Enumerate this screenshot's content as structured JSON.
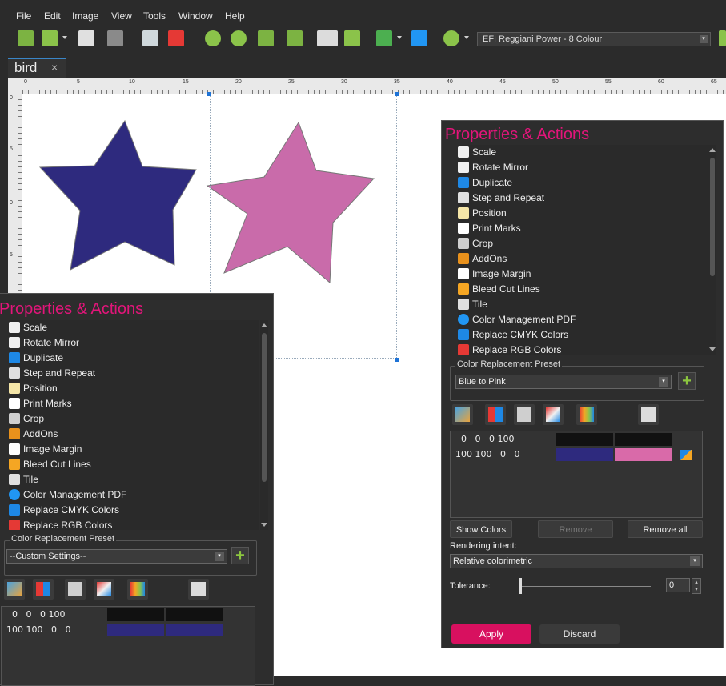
{
  "menu": [
    "File",
    "Edit",
    "Image",
    "View",
    "Tools",
    "Window",
    "Help"
  ],
  "toolbar": {
    "device": "EFI Reggiani Power - 8 Colour"
  },
  "document": {
    "tab_name": "bird",
    "tab_close": "×"
  },
  "ruler": {
    "h_ticks": [
      "0",
      "5",
      "10",
      "15",
      "20",
      "25",
      "30",
      "35",
      "40",
      "45",
      "50",
      "55",
      "60",
      "65"
    ],
    "v_ticks": [
      "0",
      "5",
      "0",
      "5"
    ]
  },
  "shapes": {
    "star1_color": "#2e2a7e",
    "star2_color": "#c96baa"
  },
  "panel_right": {
    "title": "Properties & Actions",
    "items": [
      "Scale",
      "Rotate Mirror",
      "Duplicate",
      "Step and Repeat",
      "Position",
      "Print Marks",
      "Crop",
      "AddOns",
      "Image Margin",
      "Bleed Cut Lines",
      "Tile",
      "Color Management PDF",
      "Replace CMYK Colors",
      "Replace RGB Colors"
    ],
    "preset_label": "Color Replacement Preset",
    "preset_value": "Blue to Pink",
    "plus": "+",
    "rows": [
      {
        "vals": "  0   0   0 100",
        "from": "#111111",
        "to": "#111111"
      },
      {
        "vals": "100 100   0   0",
        "from": "#2e2a7e",
        "to": "#d96aa9"
      }
    ],
    "show_colors": "Show Colors",
    "remove": "Remove",
    "remove_all": "Remove all",
    "rendering_label": "Rendering intent:",
    "rendering_value": "Relative colorimetric",
    "tolerance_label": "Tolerance:",
    "tolerance_value": "0",
    "apply": "Apply",
    "discard": "Discard"
  },
  "panel_left": {
    "title": "Properties & Actions",
    "items": [
      "Scale",
      "Rotate Mirror",
      "Duplicate",
      "Step and Repeat",
      "Position",
      "Print Marks",
      "Crop",
      "AddOns",
      "Image Margin",
      "Bleed Cut Lines",
      "Tile",
      "Color Management PDF",
      "Replace CMYK Colors",
      "Replace RGB Colors"
    ],
    "preset_label": "Color Replacement Preset",
    "preset_value": "--Custom Settings--",
    "plus": "+",
    "rows": [
      {
        "vals": "  0   0   0 100",
        "from": "#111111",
        "to": "#111111"
      },
      {
        "vals": "100 100   0   0",
        "from": "#2e2a7e",
        "to": "#2e2a7e"
      }
    ]
  },
  "icons": [
    "scale-icon",
    "rotate-mirror-icon",
    "duplicate-icon",
    "step-repeat-icon",
    "position-icon",
    "print-marks-icon",
    "crop-icon",
    "addons-icon",
    "image-margin-icon",
    "bleed-cut-lines-icon",
    "tile-icon",
    "color-management-pdf-icon",
    "replace-cmyk-icon",
    "replace-rgb-icon"
  ],
  "colors": {
    "accent": "#e2157a",
    "panel_bg": "#2d2d2d",
    "apply": "#d8105f"
  }
}
